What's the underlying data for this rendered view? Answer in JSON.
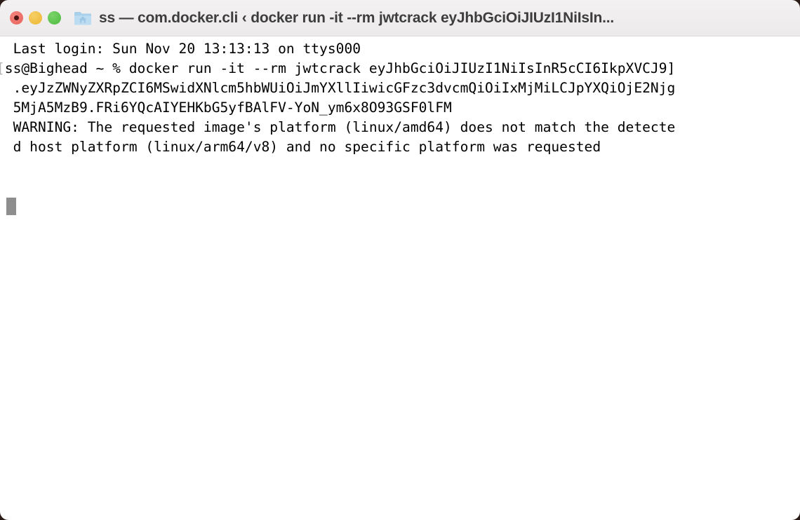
{
  "window": {
    "title": "ss — com.docker.cli ‹ docker run -it --rm jwtcrack eyJhbGciOiJIUzI1NiIsIn...",
    "folder_icon": "home-folder-icon",
    "traffic_lights": [
      {
        "name": "close-button",
        "label": "Close",
        "color": "#e8635c"
      },
      {
        "name": "minimize-button",
        "label": "Minimize",
        "color": "#ecb731"
      },
      {
        "name": "zoom-button",
        "label": "Zoom",
        "color": "#4cbb3d"
      }
    ]
  },
  "terminal": {
    "background": "#ffffff",
    "foreground": "#000000",
    "cursor_color": "#8e8e8e",
    "lines": [
      "  Last login: Sun Nov 20 13:13:13 on ttys000",
      "[ss@Bighead ~ % docker run -it --rm jwtcrack eyJhbGciOiJIUzI1NiIsInR5cCI6IkpXVCJ9]",
      "  .eyJzZWNyZXRpZCI6MSwidXNlcm5hbWUiOiJmYXllIiwicGFzc3dvcmQiOiIxMjMiLCJpYXQiOjE2Njg",
      "  5MjA5MzB9.FRi6YQcAIYEHKbG5yfBAlFV-YoN_ym6x8O93GSF0lFM",
      "  WARNING: The requested image's platform (linux/amd64) does not match the detecte",
      "  d host platform (linux/arm64/v8) and no specific platform was requested"
    ]
  }
}
